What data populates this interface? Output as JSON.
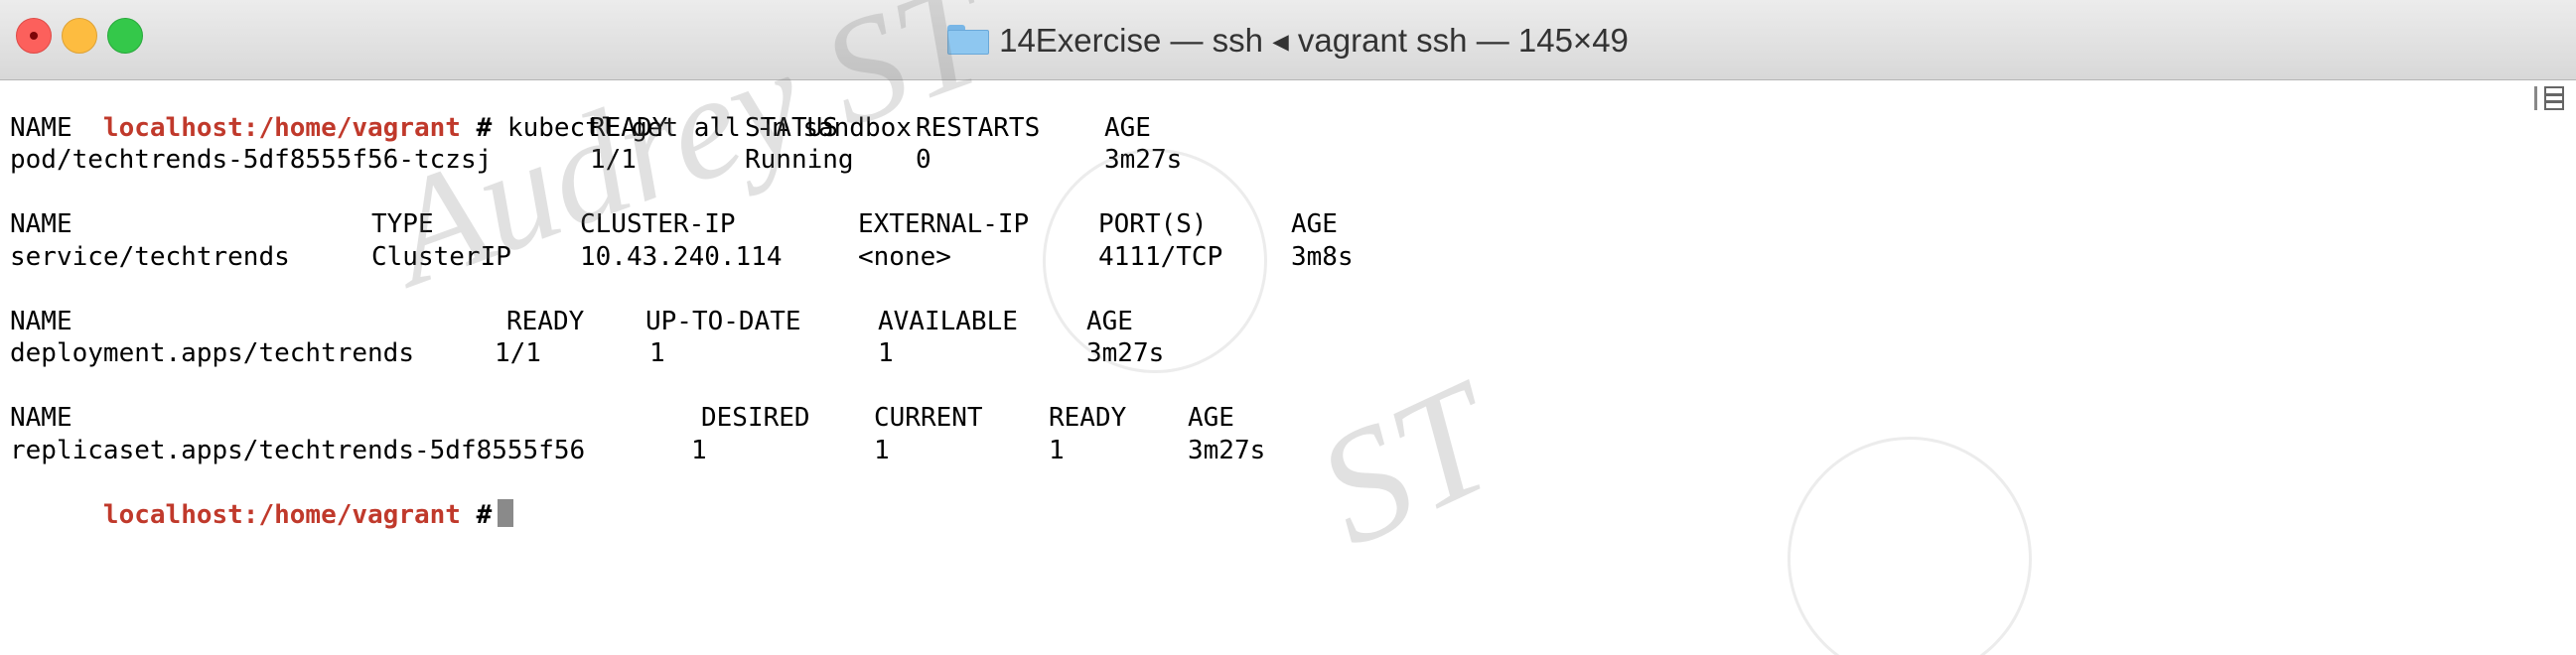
{
  "window": {
    "title": "14Exercise — ssh ◂ vagrant ssh — 145×49"
  },
  "terminal": {
    "prompt": "localhost:/home/vagrant",
    "prompt_symbol": "#",
    "command": "kubectl get all -n sandbox",
    "pods": {
      "headers": [
        "NAME",
        "READY",
        "STATUS",
        "RESTARTS",
        "AGE"
      ],
      "rows": [
        [
          "pod/techtrends-5df8555f56-tczsj",
          "1/1",
          "Running",
          "0",
          "3m27s"
        ]
      ]
    },
    "services": {
      "headers": [
        "NAME",
        "TYPE",
        "CLUSTER-IP",
        "EXTERNAL-IP",
        "PORT(S)",
        "AGE"
      ],
      "rows": [
        [
          "service/techtrends",
          "ClusterIP",
          "10.43.240.114",
          "<none>",
          "4111/TCP",
          "3m8s"
        ]
      ]
    },
    "deployments": {
      "headers": [
        "NAME",
        "READY",
        "UP-TO-DATE",
        "AVAILABLE",
        "AGE"
      ],
      "rows": [
        [
          "deployment.apps/techtrends",
          "1/1",
          "1",
          "1",
          "3m27s"
        ]
      ]
    },
    "replicasets": {
      "headers": [
        "NAME",
        "DESIRED",
        "CURRENT",
        "READY",
        "AGE"
      ],
      "rows": [
        [
          "replicaset.apps/techtrends-5df8555f56",
          "1",
          "1",
          "1",
          "3m27s"
        ]
      ]
    }
  },
  "watermark": {
    "text_1": "Audrey ST",
    "text_2": "ST"
  },
  "colors": {
    "prompt": "#c0392b",
    "close_button": "#fc605c",
    "minimize_button": "#fdbc40",
    "zoom_button": "#34c84a"
  }
}
